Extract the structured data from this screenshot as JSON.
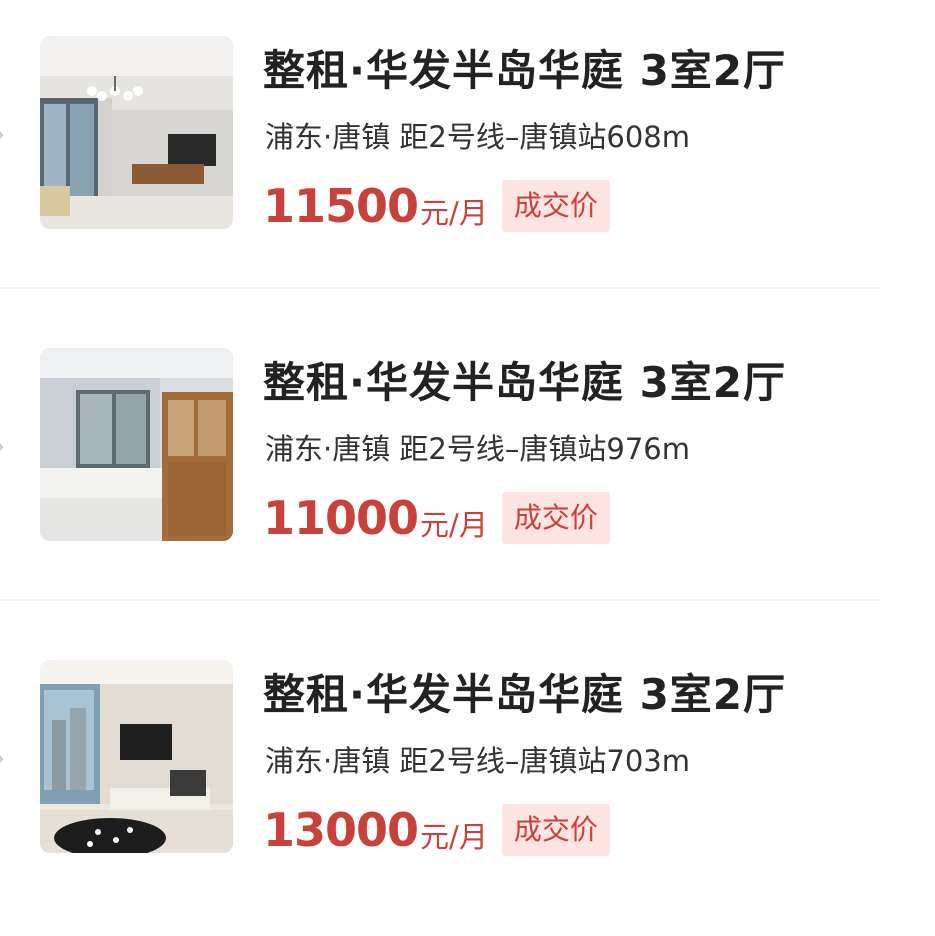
{
  "listings": [
    {
      "title": "整租·华发半岛华庭 3室2厅",
      "location": "浦东·唐镇 距2号线–唐镇站608m",
      "price": "11500",
      "unit": "元/月",
      "badge": "成交价"
    },
    {
      "title": "整租·华发半岛华庭 3室2厅",
      "location": "浦东·唐镇 距2号线–唐镇站976m",
      "price": "11000",
      "unit": "元/月",
      "badge": "成交价"
    },
    {
      "title": "整租·华发半岛华庭 3室2厅",
      "location": "浦东·唐镇 距2号线–唐镇站703m",
      "price": "13000",
      "unit": "元/月",
      "badge": "成交价"
    }
  ],
  "icons": {
    "expand": "chevron-right-icon"
  },
  "colors": {
    "price": "#c8423b",
    "badge_bg": "#fde4e2",
    "title": "#222222",
    "divider": "#f0f0f0"
  }
}
